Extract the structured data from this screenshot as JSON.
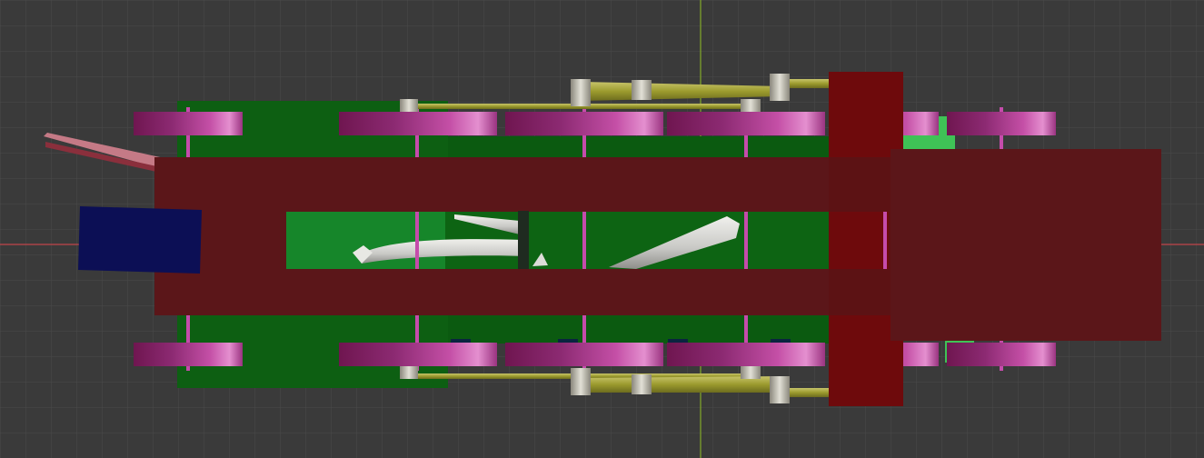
{
  "app": {
    "view_mode": "top-orthographic",
    "object_count": 1
  },
  "viewport": {
    "background_color": "#3a3a3a",
    "grid_color": "#4a4a4a",
    "x_axis_color": "#c0454a",
    "y_axis_color": "#7da12a"
  },
  "model": {
    "name": "",
    "colors": {
      "frame": "#5b1619",
      "frame_block": "#6e0a0c",
      "deck_green": "#0d5f12",
      "bright_green": "#16862a",
      "accent_green": "#3fc256",
      "gear_pink": "#b23f96",
      "gear_dark": "#6f1650",
      "shaft_pink": "#c54cab",
      "rod_yellow": "#9c9b2e",
      "pipe_grey": "#c9c9c6",
      "bolt_grey": "#b9b6a8",
      "navy_block": "#0c0f55",
      "antenna_pink": "#c57a86"
    },
    "gear_count": 12,
    "shaft_count": 6,
    "link_rod_count": 4
  }
}
